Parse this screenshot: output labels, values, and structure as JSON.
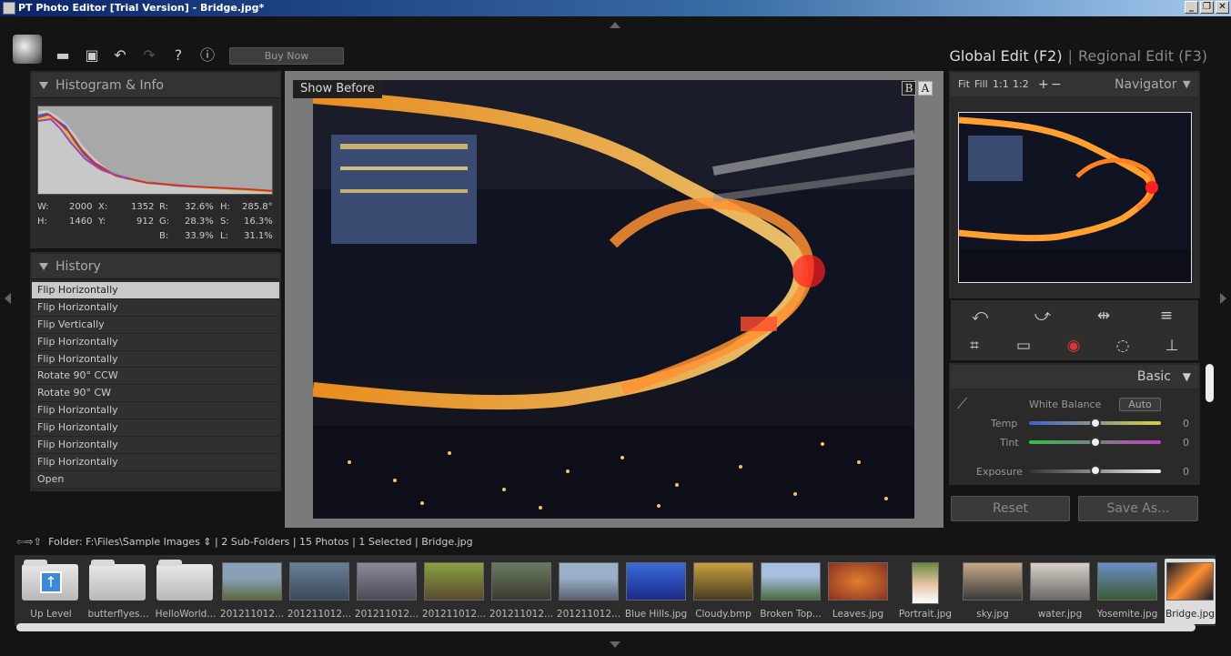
{
  "window": {
    "title": "PT Photo Editor [Trial Version] - Bridge.jpg*"
  },
  "toolbar": {
    "buy_label": "Buy Now"
  },
  "modes": {
    "global": "Global Edit (F2)",
    "regional": "Regional Edit (F3)"
  },
  "histogram": {
    "title": "Histogram & Info",
    "w_label": "W:",
    "w": "2000",
    "h_label": "H:",
    "h": "1460",
    "x_label": "X:",
    "x": "1352",
    "y_label": "Y:",
    "y": "912",
    "r_label": "R:",
    "r": "32.6%",
    "g_label": "G:",
    "g": "28.3%",
    "b_label": "B:",
    "b": "33.9%",
    "hue_label": "H:",
    "hue": "285.8°",
    "s_label": "S:",
    "s": "16.3%",
    "l_label": "L:",
    "l": "31.1%"
  },
  "history": {
    "title": "History",
    "items": [
      "Flip Horizontally",
      "Flip Horizontally",
      "Flip Vertically",
      "Flip Horizontally",
      "Flip Horizontally",
      "Rotate 90° CCW",
      "Rotate 90° CW",
      "Flip Horizontally",
      "Flip Horizontally",
      "Flip Horizontally",
      "Flip Horizontally",
      "Open"
    ]
  },
  "canvas": {
    "show_before": "Show Before",
    "b_label": "B",
    "a_label": "A"
  },
  "navigator": {
    "fit": "Fit",
    "fill": "Fill",
    "one_one": "1:1",
    "one_two": "1:2",
    "plus": "+",
    "minus": "−",
    "title": "Navigator"
  },
  "basic": {
    "title": "Basic",
    "white_balance": "White Balance",
    "auto": "Auto",
    "temp_label": "Temp",
    "temp_value": "0",
    "tint_label": "Tint",
    "tint_value": "0",
    "exposure_label": "Exposure",
    "exposure_value": "0"
  },
  "actions": {
    "reset": "Reset",
    "save_as": "Save As..."
  },
  "pathbar": {
    "text": "Folder:  F:\\Files\\Sample Images ⇕ | 2 Sub-Folders | 15 Photos | 1 Selected | Bridge.jpg"
  },
  "filmstrip": [
    {
      "label": "Up Level"
    },
    {
      "label": "butterflyes..."
    },
    {
      "label": "HelloWorld..."
    },
    {
      "label": "201211012..."
    },
    {
      "label": "201211012..."
    },
    {
      "label": "201211012..."
    },
    {
      "label": "201211012..."
    },
    {
      "label": "201211012..."
    },
    {
      "label": "201211012..."
    },
    {
      "label": "Blue Hills.jpg"
    },
    {
      "label": "Cloudy.bmp"
    },
    {
      "label": "Broken Top..."
    },
    {
      "label": "Leaves.jpg"
    },
    {
      "label": "Portrait.jpg"
    },
    {
      "label": "sky.jpg"
    },
    {
      "label": "water.jpg"
    },
    {
      "label": "Yosemite.jpg"
    },
    {
      "label": "Bridge.jpg"
    }
  ]
}
